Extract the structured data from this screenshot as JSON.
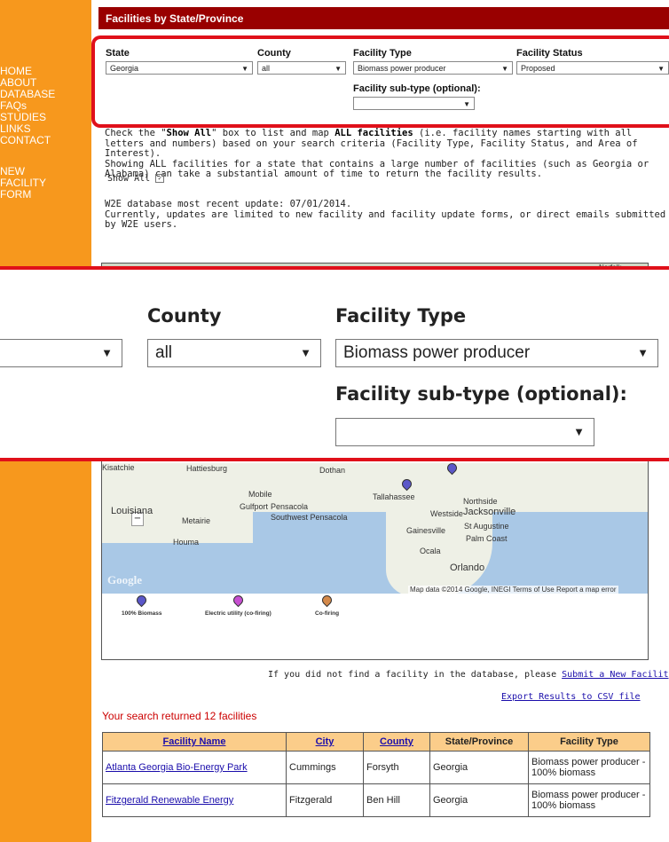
{
  "nav": {
    "items": [
      "HOME",
      "ABOUT",
      "DATABASE",
      "FAQs",
      "STUDIES",
      "LINKS",
      "CONTACT"
    ],
    "new_facility": [
      "NEW",
      "FACILITY",
      "FORM"
    ]
  },
  "header": {
    "title": "Facilities by State/Province"
  },
  "filters": {
    "state_label": "State",
    "state_value": "Georgia",
    "county_label": "County",
    "county_value": "all",
    "type_label": "Facility Type",
    "type_value": "Biomass power producer",
    "status_label": "Facility Status",
    "status_value": "Proposed",
    "subtype_label": "Facility sub-type (optional):",
    "subtype_value": ""
  },
  "info": {
    "p1_a": "Check the \"",
    "p1_bold1": "Show All",
    "p1_b": "\" box to list and map ",
    "p1_bold2": "ALL facilities",
    "p1_c": " (i.e. facility names starting with all letters and numbers) based on your search criteria (Facility Type, Facility Status, and Area of Interest).",
    "p2": "Showing ALL facilities for a state that contains a large number of facilities (such as Georgia or Alabama) can take a substantial amount of time to return the facility results.",
    "show_all_label": "Show All",
    "update_line1": "W2E database most recent update: 07/01/2014.",
    "update_line2": "Currently, updates are limited to new facility and facility update forms, or direct emails submitted by W2E users."
  },
  "map": {
    "top_label": "Norfolk",
    "places": [
      "Hattiesburg",
      "Dothan",
      "Mobile",
      "Gulfport",
      "Pensacola",
      "Southwest Pensacola",
      "Tallahassee",
      "Northside",
      "Westside",
      "Jacksonville",
      "Louisiana",
      "Metairie",
      "Houma",
      "Gainesville",
      "St Augustine",
      "Palm Coast",
      "Ocala",
      "Orlando"
    ],
    "brand": "Google",
    "attribution": "Map data ©2014 Google, INEGI    Terms of Use    Report a map error",
    "legend": [
      {
        "label": "100% Biomass",
        "color": "#5b57c9"
      },
      {
        "label": "Electric utility (co-firing)",
        "color": "#c74fd1"
      },
      {
        "label": "Co-firing",
        "color": "#d4894a"
      }
    ]
  },
  "notes": {
    "submit_text": "If you did not find a facility in the database, please ",
    "submit_link": "Submit a New Facility Form",
    "export_link": "Export Results to CSV file"
  },
  "results": {
    "count_text": "Your search returned 12 facilities",
    "headers": [
      "Facility Name",
      "City",
      "County",
      "State/Province",
      "Facility Type"
    ],
    "rows": [
      [
        "Atlanta Georgia Bio-Energy Park",
        "Cummings",
        "Forsyth",
        "Georgia",
        "Biomass power producer - 100% biomass"
      ],
      [
        "Fitzgerald Renewable Energy",
        "Fitzgerald",
        "Ben Hill",
        "Georgia",
        "Biomass power producer - 100% biomass"
      ]
    ]
  }
}
